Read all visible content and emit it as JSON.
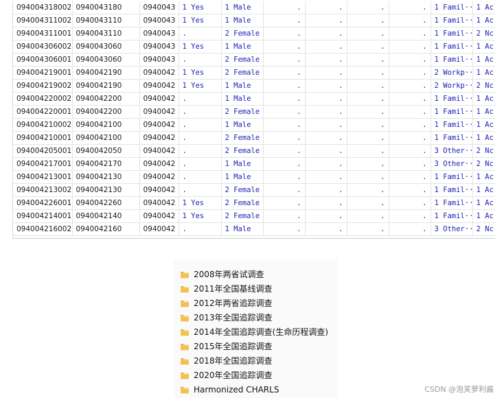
{
  "table": {
    "rows": [
      [
        "094004318002",
        "0940043180",
        "0940043",
        "1 Yes",
        "1 Male",
        ".",
        ".",
        ".",
        ".",
        "1 Famil···",
        "1 Ac"
      ],
      [
        "094004311002",
        "0940043110",
        "0940043",
        "1 Yes",
        "1 Male",
        ".",
        ".",
        ".",
        ".",
        "1 Famil···",
        "1 Ac"
      ],
      [
        "094004311001",
        "0940043110",
        "0940043",
        ".",
        "2 Female",
        ".",
        ".",
        ".",
        ".",
        "1 Famil···",
        "2 Nc"
      ],
      [
        "094004306002",
        "0940043060",
        "0940043",
        "1 Yes",
        "1 Male",
        ".",
        ".",
        ".",
        ".",
        "1 Famil···",
        "1 Ac"
      ],
      [
        "094004306001",
        "0940043060",
        "0940043",
        ".",
        "2 Female",
        ".",
        ".",
        ".",
        ".",
        "1 Famil···",
        "1 Ac"
      ],
      [
        "094004219001",
        "0940042190",
        "0940042",
        "1 Yes",
        "2 Female",
        ".",
        ".",
        ".",
        ".",
        "2 Workp···",
        "1 Ac"
      ],
      [
        "094004219002",
        "0940042190",
        "0940042",
        "1 Yes",
        "1 Male",
        ".",
        ".",
        ".",
        ".",
        "2 Workp···",
        "2 Nc"
      ],
      [
        "094004220002",
        "0940042200",
        "0940042",
        ".",
        "1 Male",
        ".",
        ".",
        ".",
        ".",
        "1 Famil···",
        "1 Ac"
      ],
      [
        "094004220001",
        "0940042200",
        "0940042",
        ".",
        "2 Female",
        ".",
        ".",
        ".",
        ".",
        "1 Famil···",
        "1 Ac"
      ],
      [
        "094004210002",
        "0940042100",
        "0940042",
        ".",
        "1 Male",
        ".",
        ".",
        ".",
        ".",
        "1 Famil···",
        "1 Ac"
      ],
      [
        "094004210001",
        "0940042100",
        "0940042",
        ".",
        "2 Female",
        ".",
        ".",
        ".",
        ".",
        "1 Famil···",
        "1 Ac"
      ],
      [
        "094004205001",
        "0940042050",
        "0940042",
        ".",
        "2 Female",
        ".",
        ".",
        ".",
        ".",
        "3 Other···",
        "2 Nc"
      ],
      [
        "094004217001",
        "0940042170",
        "0940042",
        ".",
        "1 Male",
        ".",
        ".",
        ".",
        ".",
        "3 Other···",
        "2 Nc"
      ],
      [
        "094004213001",
        "0940042130",
        "0940042",
        ".",
        "1 Male",
        ".",
        ".",
        ".",
        ".",
        "1 Famil···",
        "1 Ac"
      ],
      [
        "094004213002",
        "0940042130",
        "0940042",
        ".",
        "2 Female",
        ".",
        ".",
        ".",
        ".",
        "1 Famil···",
        "1 Ac"
      ],
      [
        "094004226001",
        "0940042260",
        "0940042",
        "1 Yes",
        "2 Female",
        ".",
        ".",
        ".",
        ".",
        "1 Famil···",
        "1 Ac"
      ],
      [
        "094004214001",
        "0940042140",
        "0940042",
        "1 Yes",
        "2 Female",
        ".",
        ".",
        ".",
        ".",
        "1 Famil···",
        "1 Ac"
      ],
      [
        "094004216002",
        "0940042160",
        "0940042",
        ".",
        "1 Male",
        ".",
        ".",
        ".",
        ".",
        "3 Other···",
        "2 Nc"
      ]
    ]
  },
  "folders": [
    {
      "name": "2008年两省试调查",
      "icon": "folder-icon"
    },
    {
      "name": "2011年全国基线调查",
      "icon": "folder-icon"
    },
    {
      "name": "2012年两省追踪调查",
      "icon": "folder-icon"
    },
    {
      "name": "2013年全国追踪调查",
      "icon": "folder-icon"
    },
    {
      "name": "2014年全国追踪调查(生命历程调查)",
      "icon": "folder-icon"
    },
    {
      "name": "2015年全国追踪调查",
      "icon": "folder-icon"
    },
    {
      "name": "2018年全国追踪调查",
      "icon": "folder-icon"
    },
    {
      "name": "2020年全国追踪调查",
      "icon": "folder-icon"
    },
    {
      "name": "Harmonized CHARLS",
      "icon": "folder-icon"
    }
  ],
  "watermark": "CSDN @泡芙萝利酱",
  "colors": {
    "value_label": "#1f22b6",
    "folder": "#e8b43a"
  }
}
